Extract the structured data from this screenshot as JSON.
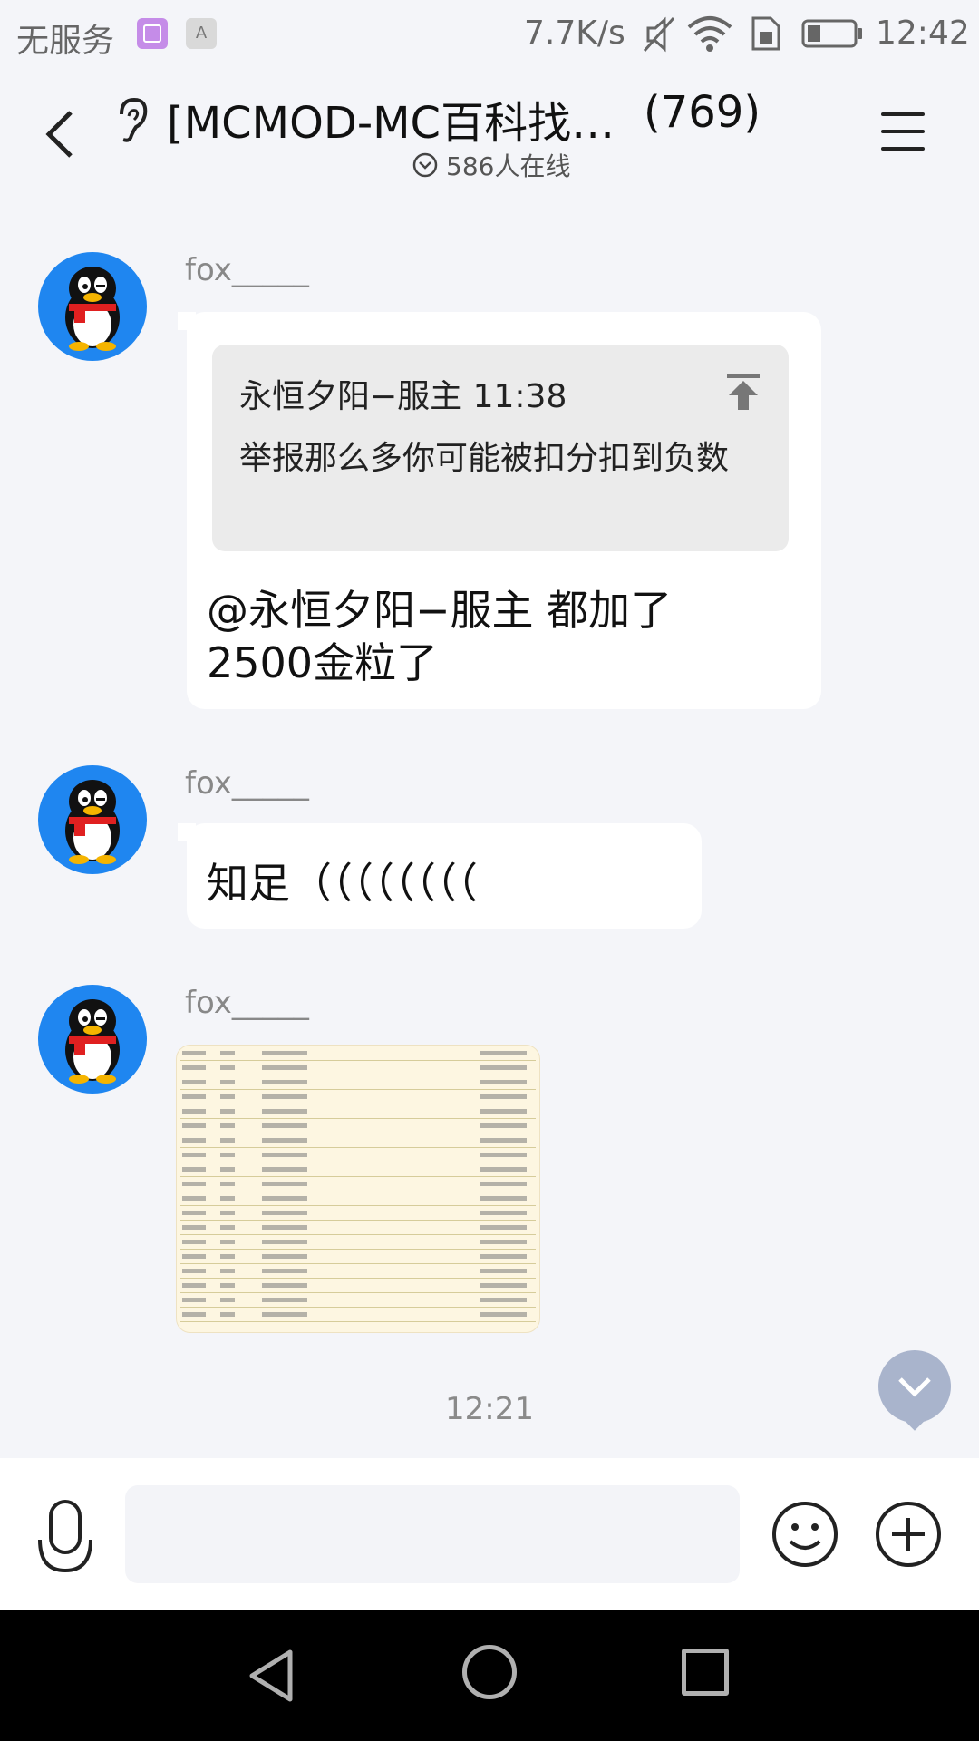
{
  "status_bar": {
    "carrier": "无服务",
    "app_icon_a": "A",
    "speed": "7.7K/s",
    "time": "12:42",
    "icons": [
      "gallery-icon",
      "a-icon",
      "mute-icon",
      "wifi-icon",
      "sim-icon",
      "battery-icon"
    ]
  },
  "header": {
    "title": "[MCMOD-MC百科找…",
    "member_count": "(769)",
    "online": "586人在线",
    "icons": [
      "back-icon",
      "ear-icon",
      "online-chevron-icon",
      "menu-icon"
    ]
  },
  "messages": [
    {
      "sender": "fox_____",
      "quote": {
        "author_time": "永恒夕阳−服主 11:38",
        "text": "举报那么多你可能被扣分扣到负数"
      },
      "text": "@永恒夕阳−服主 都加了2500金粒了"
    },
    {
      "sender": "fox_____",
      "text": "知足（（（（（（（（"
    },
    {
      "sender": "fox_____",
      "type": "image"
    }
  ],
  "timestamp": "12:21",
  "input": {
    "placeholder": "",
    "icons": [
      "mic-icon",
      "emoji-icon",
      "plus-icon"
    ]
  },
  "colors": {
    "background": "#f4f5f9",
    "avatar_blue": "#1f86f0",
    "scroll_button": "#a9b4cc"
  }
}
